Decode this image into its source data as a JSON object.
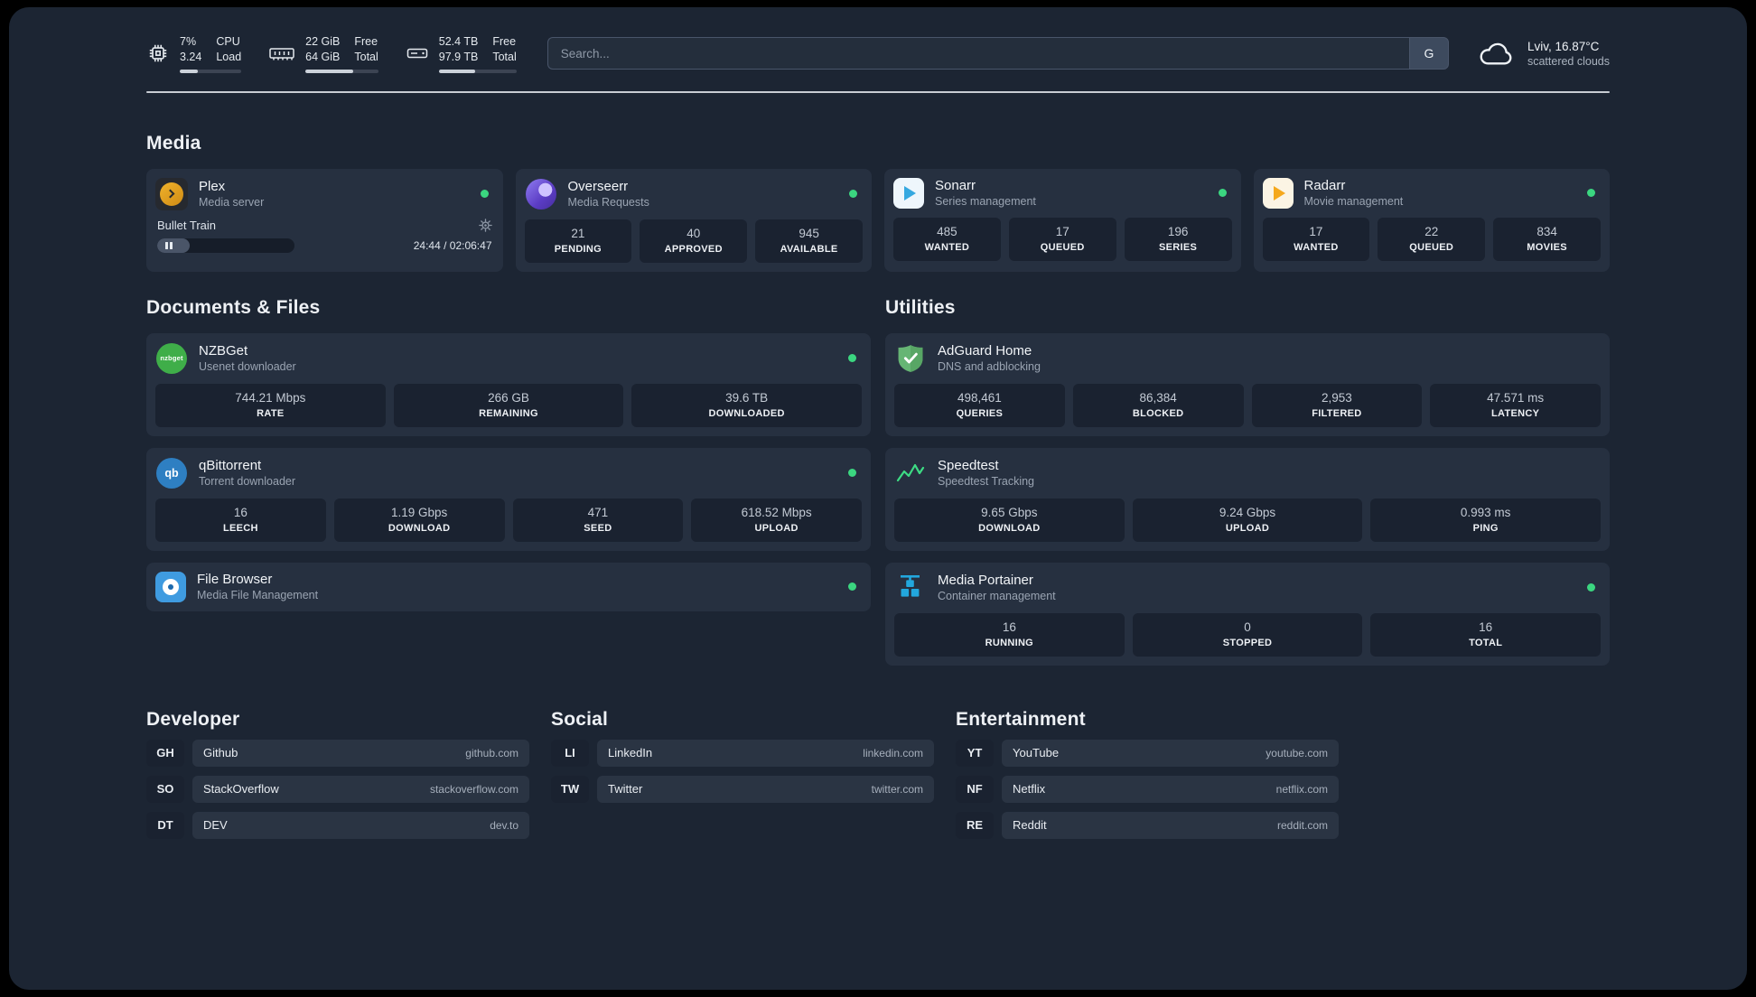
{
  "topbar": {
    "cpu": {
      "value_top": "7%",
      "value_bottom": "3.24",
      "label_top": "CPU",
      "label_bottom": "Load",
      "bar_percent": 30
    },
    "ram": {
      "value_top": "22 GiB",
      "value_bottom": "64 GiB",
      "label_top": "Free",
      "label_bottom": "Total",
      "bar_percent": 65
    },
    "disk": {
      "value_top": "52.4 TB",
      "value_bottom": "97.9 TB",
      "label_top": "Free",
      "label_bottom": "Total",
      "bar_percent": 47
    },
    "search": {
      "placeholder": "Search...",
      "engine_label": "G"
    },
    "weather": {
      "location": "Lviv, 16.87°C",
      "condition": "scattered clouds"
    }
  },
  "media": {
    "title": "Media",
    "plex": {
      "name": "Plex",
      "desc": "Media server",
      "now_playing": "Bullet Train",
      "time": "24:44 / 02:06:47",
      "progress_percent": 24
    },
    "overseerr": {
      "name": "Overseerr",
      "desc": "Media Requests",
      "stats": [
        {
          "value": "21",
          "label": "PENDING"
        },
        {
          "value": "40",
          "label": "APPROVED"
        },
        {
          "value": "945",
          "label": "AVAILABLE"
        }
      ]
    },
    "sonarr": {
      "name": "Sonarr",
      "desc": "Series management",
      "stats": [
        {
          "value": "485",
          "label": "WANTED"
        },
        {
          "value": "17",
          "label": "QUEUED"
        },
        {
          "value": "196",
          "label": "SERIES"
        }
      ]
    },
    "radarr": {
      "name": "Radarr",
      "desc": "Movie management",
      "stats": [
        {
          "value": "17",
          "label": "WANTED"
        },
        {
          "value": "22",
          "label": "QUEUED"
        },
        {
          "value": "834",
          "label": "MOVIES"
        }
      ]
    }
  },
  "documents": {
    "title": "Documents & Files",
    "nzbget": {
      "name": "NZBGet",
      "desc": "Usenet downloader",
      "icon_text": "nzbget",
      "stats": [
        {
          "value": "744.21 Mbps",
          "label": "RATE"
        },
        {
          "value": "266 GB",
          "label": "REMAINING"
        },
        {
          "value": "39.6 TB",
          "label": "DOWNLOADED"
        }
      ]
    },
    "qbittorrent": {
      "name": "qBittorrent",
      "desc": "Torrent downloader",
      "icon_text": "qb",
      "stats": [
        {
          "value": "16",
          "label": "LEECH"
        },
        {
          "value": "1.19 Gbps",
          "label": "DOWNLOAD"
        },
        {
          "value": "471",
          "label": "SEED"
        },
        {
          "value": "618.52 Mbps",
          "label": "UPLOAD"
        }
      ]
    },
    "filebrowser": {
      "name": "File Browser",
      "desc": "Media File Management"
    }
  },
  "utilities": {
    "title": "Utilities",
    "adguard": {
      "name": "AdGuard Home",
      "desc": "DNS and adblocking",
      "stats": [
        {
          "value": "498,461",
          "label": "QUERIES"
        },
        {
          "value": "86,384",
          "label": "BLOCKED"
        },
        {
          "value": "2,953",
          "label": "FILTERED"
        },
        {
          "value": "47.571 ms",
          "label": "LATENCY"
        }
      ]
    },
    "speedtest": {
      "name": "Speedtest",
      "desc": "Speedtest Tracking",
      "stats": [
        {
          "value": "9.65 Gbps",
          "label": "DOWNLOAD"
        },
        {
          "value": "9.24 Gbps",
          "label": "UPLOAD"
        },
        {
          "value": "0.993 ms",
          "label": "PING"
        }
      ]
    },
    "portainer": {
      "name": "Media Portainer",
      "desc": "Container management",
      "stats": [
        {
          "value": "16",
          "label": "RUNNING"
        },
        {
          "value": "0",
          "label": "STOPPED"
        },
        {
          "value": "16",
          "label": "TOTAL"
        }
      ]
    }
  },
  "developer": {
    "title": "Developer",
    "items": [
      {
        "abbr": "GH",
        "name": "Github",
        "url": "github.com"
      },
      {
        "abbr": "SO",
        "name": "StackOverflow",
        "url": "stackoverflow.com"
      },
      {
        "abbr": "DT",
        "name": "DEV",
        "url": "dev.to"
      }
    ]
  },
  "social": {
    "title": "Social",
    "items": [
      {
        "abbr": "LI",
        "name": "LinkedIn",
        "url": "linkedin.com"
      },
      {
        "abbr": "TW",
        "name": "Twitter",
        "url": "twitter.com"
      }
    ]
  },
  "entertainment": {
    "title": "Entertainment",
    "items": [
      {
        "abbr": "YT",
        "name": "YouTube",
        "url": "youtube.com"
      },
      {
        "abbr": "NF",
        "name": "Netflix",
        "url": "netflix.com"
      },
      {
        "abbr": "RE",
        "name": "Reddit",
        "url": "reddit.com"
      }
    ]
  }
}
